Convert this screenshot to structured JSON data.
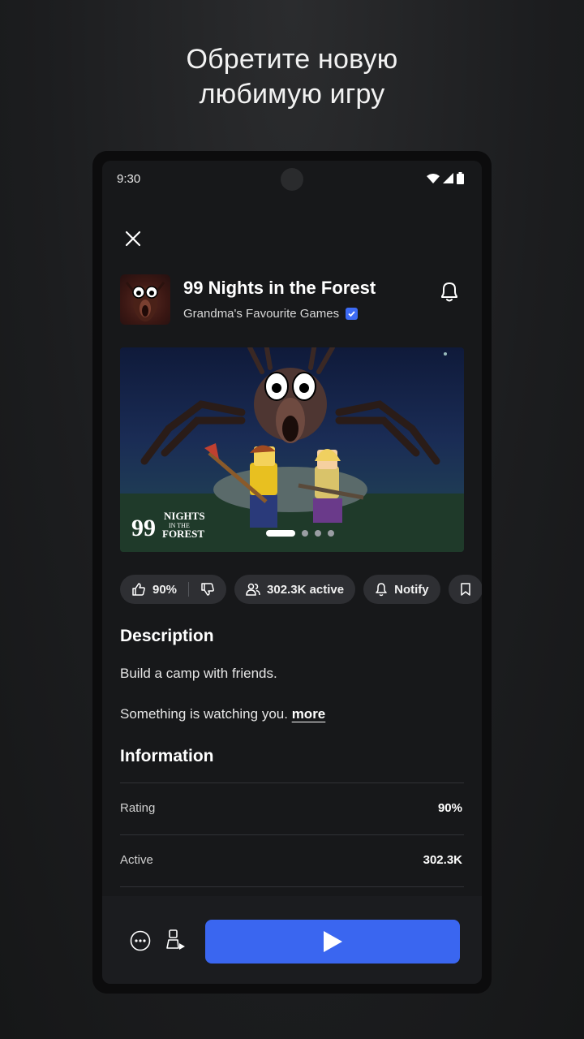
{
  "promo": {
    "line1": "Обретите новую",
    "line2": "любимую игру"
  },
  "status_bar": {
    "time": "9:30"
  },
  "game": {
    "title": "99 Nights in the Forest",
    "creator": "Grandma's Favourite Games",
    "hero_logo": "99 NIGHTS IN THE FOREST"
  },
  "stats": {
    "rating": "90%",
    "active": "302.3K active",
    "notify": "Notify"
  },
  "description": {
    "heading": "Description",
    "line1": "Build a camp with friends.",
    "line2": "Something is watching you.",
    "more": "more"
  },
  "information": {
    "heading": "Information",
    "rows": [
      {
        "label": "Rating",
        "value": "90%"
      },
      {
        "label": "Active",
        "value": "302.3K"
      }
    ]
  },
  "carousel": {
    "count": 4,
    "active_index": 0
  },
  "colors": {
    "accent": "#3a66f0",
    "background": "#17181a",
    "chip": "#2e2f33"
  },
  "icons": [
    "close-icon",
    "bell-icon",
    "thumbs-up-icon",
    "thumbs-down-icon",
    "people-icon",
    "bookmark-icon",
    "more-icon",
    "avatar-icon",
    "play-icon",
    "verified-icon",
    "wifi-icon",
    "signal-icon",
    "battery-icon"
  ]
}
